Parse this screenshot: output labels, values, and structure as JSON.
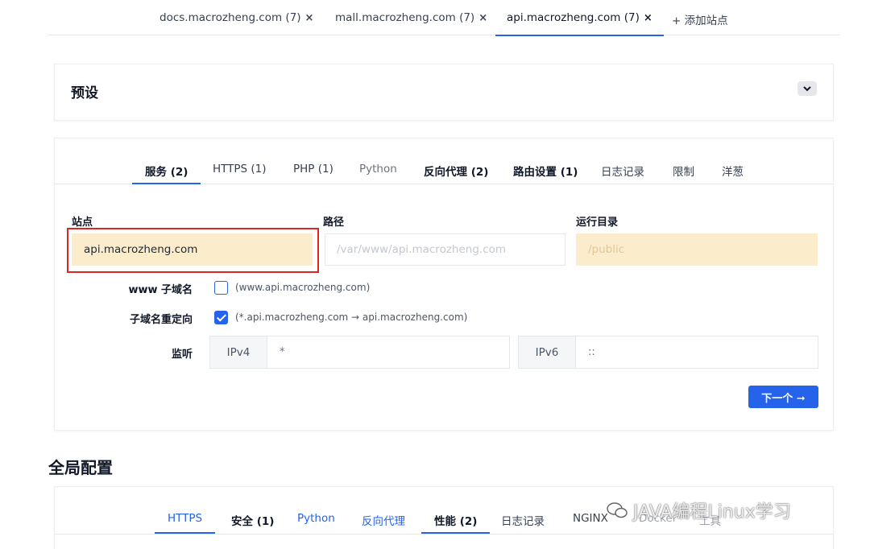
{
  "site_tabs": [
    {
      "label": "docs.macrozheng.com (7)",
      "close": "×"
    },
    {
      "label": "mall.macrozheng.com (7)",
      "close": "×"
    },
    {
      "label": "api.macrozheng.com (7)",
      "close": "×"
    }
  ],
  "add_site": "+ 添加站点",
  "presets": {
    "title": "预设"
  },
  "config_tabs": [
    "服务 (2)",
    "HTTPS (1)",
    "PHP (1)",
    "Python",
    "反向代理 (2)",
    "路由设置 (1)",
    "日志记录",
    "限制",
    "洋葱"
  ],
  "form": {
    "site_label": "站点",
    "site_value": "api.macrozheng.com",
    "path_label": "路径",
    "path_placeholder": "/var/www/api.macrozheng.com",
    "root_label": "运行目录",
    "root_placeholder": "/public",
    "www_label": "www 子域名",
    "www_hint": "(www.api.macrozheng.com)",
    "redirect_label": "子域名重定向",
    "redirect_hint": "(*.api.macrozheng.com → api.macrozheng.com)",
    "listen_label": "监听",
    "ipv4_label": "IPv4",
    "ipv4_value": "*",
    "ipv6_label": "IPv6",
    "ipv6_value": "::",
    "next_button": "下一个 ➞"
  },
  "global": {
    "title": "全局配置",
    "tabs": [
      "HTTPS",
      "安全 (1)",
      "Python",
      "反向代理",
      "性能 (2)",
      "日志记录",
      "NGINX",
      "Docker",
      "工具"
    ]
  },
  "watermark": "JAVA编程Linux学习",
  "colors": {
    "accent": "#2563eb",
    "highlight": "#fbeccb",
    "outline": "#dc2626"
  }
}
